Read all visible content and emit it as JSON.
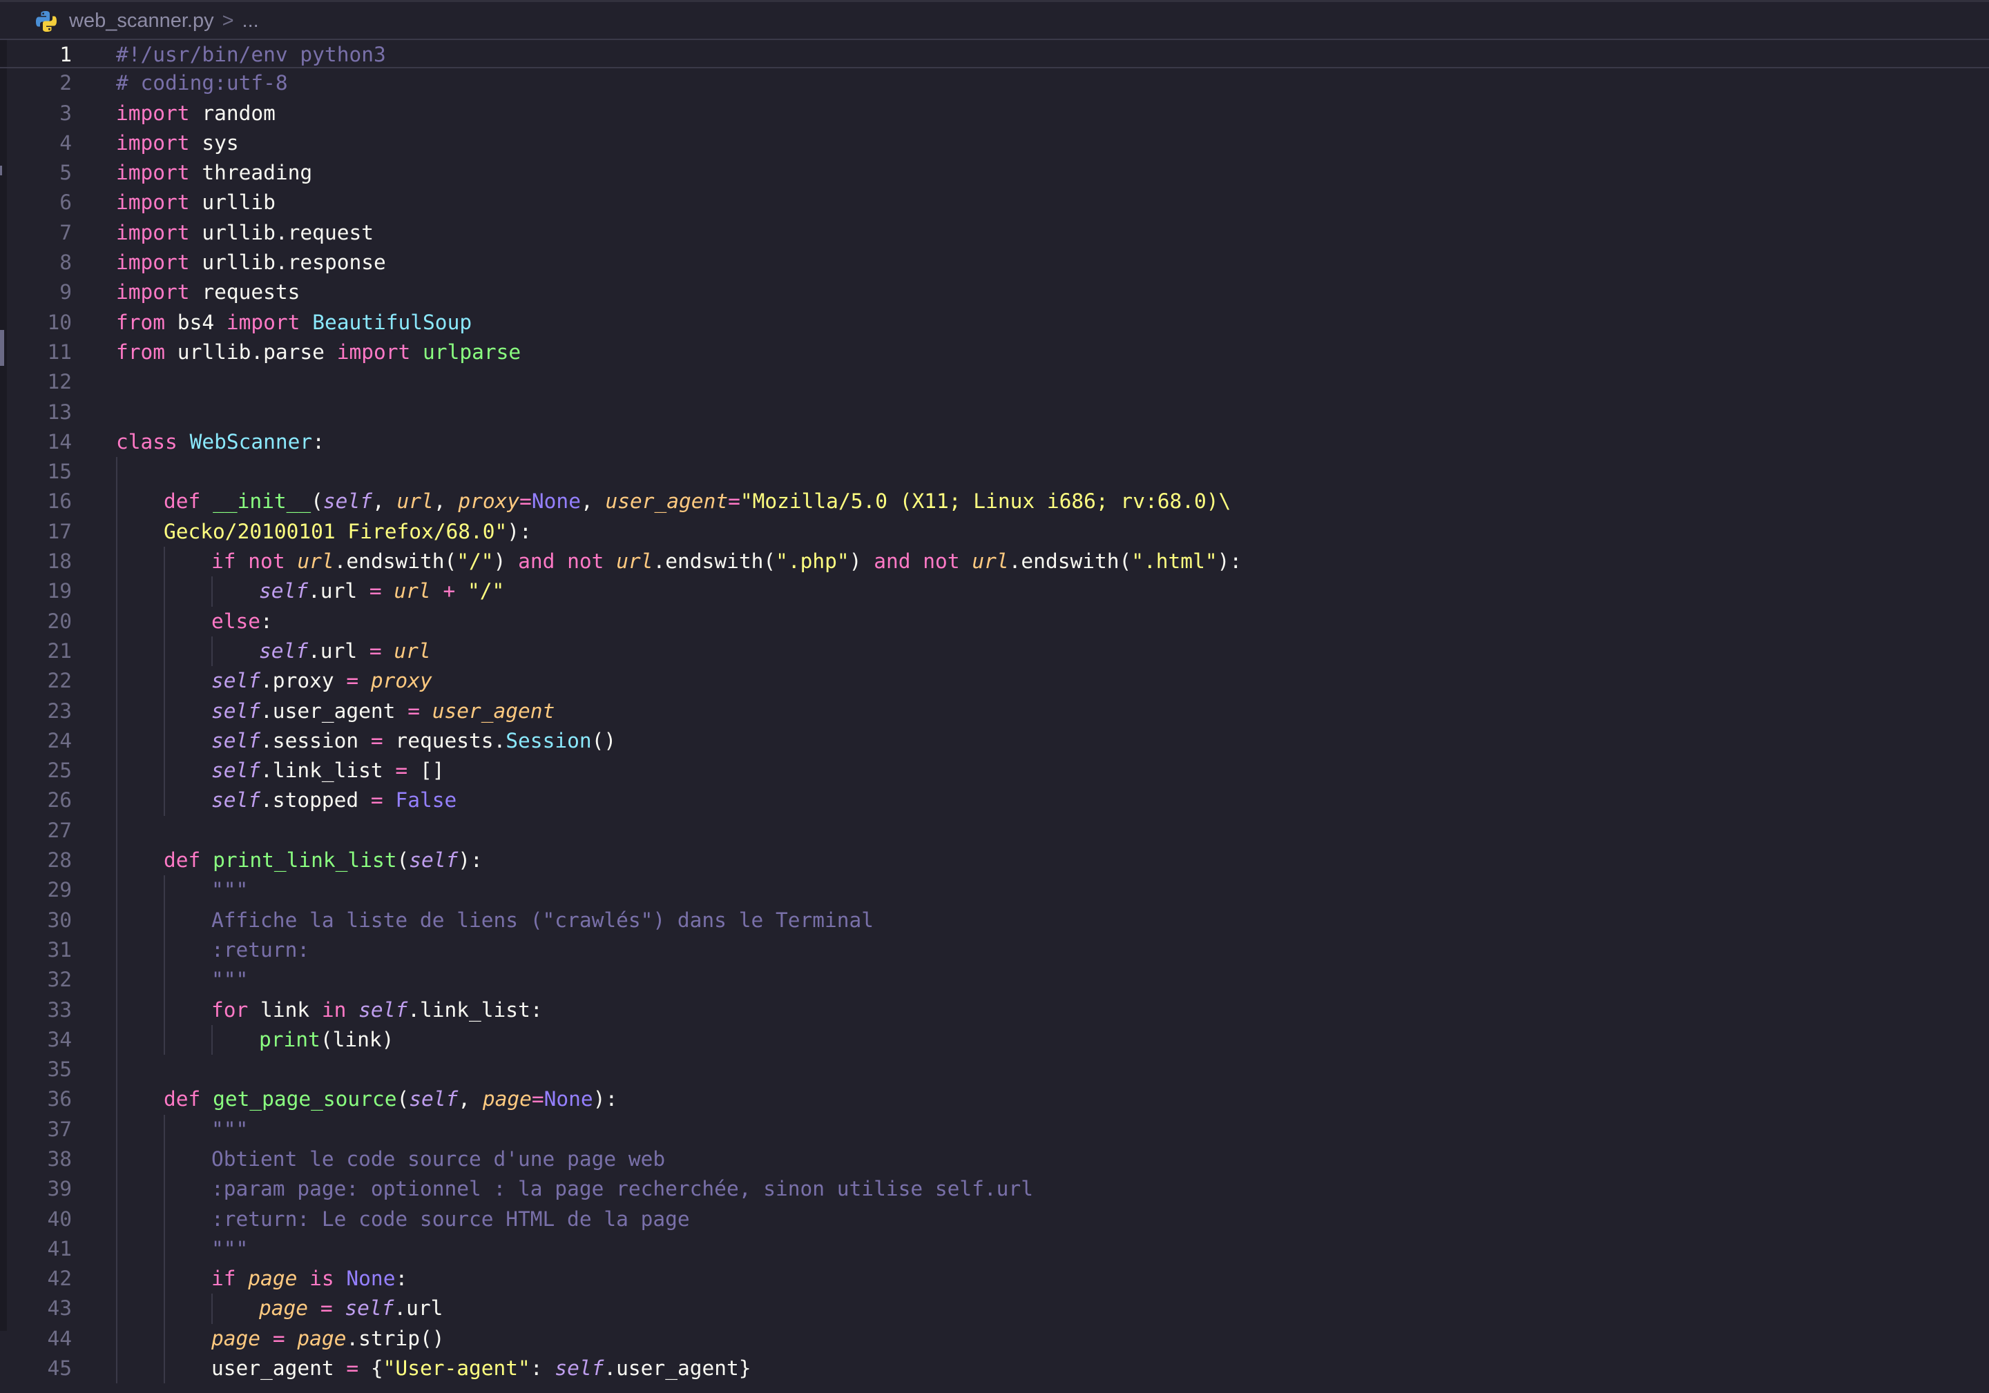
{
  "editor": {
    "breadcrumb": {
      "file": "web_scanner.py",
      "separator": ">",
      "more": "..."
    },
    "current_line": 1,
    "colors": {
      "background": "#22212c",
      "keyword": "#ff79c6",
      "comment": "#7970a9",
      "class_name": "#8be9fd",
      "function": "#8aff80",
      "self": "#bf9eee",
      "parameter": "#ffca80",
      "string": "#ffff80",
      "constant": "#9580ff"
    },
    "lines": [
      {
        "n": "1",
        "indent": 0,
        "tokens": [
          [
            "comment",
            "#!/usr/bin/env python3"
          ]
        ]
      },
      {
        "n": "2",
        "indent": 0,
        "tokens": [
          [
            "comment",
            "# coding:utf-8"
          ]
        ]
      },
      {
        "n": "3",
        "indent": 0,
        "tokens": [
          [
            "keyword",
            "import"
          ],
          [
            "plain",
            " random"
          ]
        ]
      },
      {
        "n": "4",
        "indent": 0,
        "tokens": [
          [
            "keyword",
            "import"
          ],
          [
            "plain",
            " sys"
          ]
        ]
      },
      {
        "n": "5",
        "indent": 0,
        "tokens": [
          [
            "keyword",
            "import"
          ],
          [
            "plain",
            " threading"
          ]
        ]
      },
      {
        "n": "6",
        "indent": 0,
        "tokens": [
          [
            "keyword",
            "import"
          ],
          [
            "plain",
            " urllib"
          ]
        ]
      },
      {
        "n": "7",
        "indent": 0,
        "tokens": [
          [
            "keyword",
            "import"
          ],
          [
            "plain",
            " urllib.request"
          ]
        ]
      },
      {
        "n": "8",
        "indent": 0,
        "tokens": [
          [
            "keyword",
            "import"
          ],
          [
            "plain",
            " urllib.response"
          ]
        ]
      },
      {
        "n": "9",
        "indent": 0,
        "tokens": [
          [
            "keyword",
            "import"
          ],
          [
            "plain",
            " requests"
          ]
        ]
      },
      {
        "n": "10",
        "indent": 0,
        "tokens": [
          [
            "keyword",
            "from"
          ],
          [
            "plain",
            " bs4 "
          ],
          [
            "keyword",
            "import"
          ],
          [
            "plain",
            " "
          ],
          [
            "class",
            "BeautifulSoup"
          ]
        ]
      },
      {
        "n": "11",
        "indent": 0,
        "tokens": [
          [
            "keyword",
            "from"
          ],
          [
            "plain",
            " urllib.parse "
          ],
          [
            "keyword",
            "import"
          ],
          [
            "plain",
            " "
          ],
          [
            "func",
            "urlparse"
          ]
        ]
      },
      {
        "n": "12",
        "indent": 0,
        "tokens": []
      },
      {
        "n": "13",
        "indent": 0,
        "tokens": []
      },
      {
        "n": "14",
        "indent": 0,
        "tokens": [
          [
            "keyword",
            "class"
          ],
          [
            "plain",
            " "
          ],
          [
            "class",
            "WebScanner"
          ],
          [
            "plain",
            ":"
          ]
        ]
      },
      {
        "n": "15",
        "indent": 1,
        "tokens": []
      },
      {
        "n": "16",
        "indent": 1,
        "tokens": [
          [
            "keyword",
            "def"
          ],
          [
            "plain",
            " "
          ],
          [
            "func",
            "__init__"
          ],
          [
            "plain",
            "("
          ],
          [
            "self",
            "self"
          ],
          [
            "plain",
            ", "
          ],
          [
            "param",
            "url"
          ],
          [
            "plain",
            ", "
          ],
          [
            "param",
            "proxy"
          ],
          [
            "op",
            "="
          ],
          [
            "const",
            "None"
          ],
          [
            "plain",
            ", "
          ],
          [
            "param",
            "user_agent"
          ],
          [
            "op",
            "="
          ],
          [
            "string",
            "\"Mozilla/5.0 (X11; Linux i686; rv:68.0)\\"
          ]
        ]
      },
      {
        "n": "17",
        "indent": 1,
        "tokens": [
          [
            "string",
            "Gecko/20100101 Firefox/68.0\""
          ],
          [
            "plain",
            "):"
          ]
        ]
      },
      {
        "n": "18",
        "indent": 2,
        "tokens": [
          [
            "keyword",
            "if"
          ],
          [
            "plain",
            " "
          ],
          [
            "keyword",
            "not"
          ],
          [
            "plain",
            " "
          ],
          [
            "param",
            "url"
          ],
          [
            "plain",
            ".endswith("
          ],
          [
            "string",
            "\"/\""
          ],
          [
            "plain",
            ") "
          ],
          [
            "keyword",
            "and"
          ],
          [
            "plain",
            " "
          ],
          [
            "keyword",
            "not"
          ],
          [
            "plain",
            " "
          ],
          [
            "param",
            "url"
          ],
          [
            "plain",
            ".endswith("
          ],
          [
            "string",
            "\".php\""
          ],
          [
            "plain",
            ") "
          ],
          [
            "keyword",
            "and"
          ],
          [
            "plain",
            " "
          ],
          [
            "keyword",
            "not"
          ],
          [
            "plain",
            " "
          ],
          [
            "param",
            "url"
          ],
          [
            "plain",
            ".endswith("
          ],
          [
            "string",
            "\".html\""
          ],
          [
            "plain",
            "):"
          ]
        ]
      },
      {
        "n": "19",
        "indent": 3,
        "tokens": [
          [
            "self",
            "self"
          ],
          [
            "plain",
            ".url "
          ],
          [
            "op",
            "="
          ],
          [
            "plain",
            " "
          ],
          [
            "param",
            "url"
          ],
          [
            "plain",
            " "
          ],
          [
            "op",
            "+"
          ],
          [
            "plain",
            " "
          ],
          [
            "string",
            "\"/\""
          ]
        ]
      },
      {
        "n": "20",
        "indent": 2,
        "tokens": [
          [
            "keyword",
            "else"
          ],
          [
            "plain",
            ":"
          ]
        ]
      },
      {
        "n": "21",
        "indent": 3,
        "tokens": [
          [
            "self",
            "self"
          ],
          [
            "plain",
            ".url "
          ],
          [
            "op",
            "="
          ],
          [
            "plain",
            " "
          ],
          [
            "param",
            "url"
          ]
        ]
      },
      {
        "n": "22",
        "indent": 2,
        "tokens": [
          [
            "self",
            "self"
          ],
          [
            "plain",
            ".proxy "
          ],
          [
            "op",
            "="
          ],
          [
            "plain",
            " "
          ],
          [
            "param",
            "proxy"
          ]
        ]
      },
      {
        "n": "23",
        "indent": 2,
        "tokens": [
          [
            "self",
            "self"
          ],
          [
            "plain",
            ".user_agent "
          ],
          [
            "op",
            "="
          ],
          [
            "plain",
            " "
          ],
          [
            "param",
            "user_agent"
          ]
        ]
      },
      {
        "n": "24",
        "indent": 2,
        "tokens": [
          [
            "self",
            "self"
          ],
          [
            "plain",
            ".session "
          ],
          [
            "op",
            "="
          ],
          [
            "plain",
            " requests."
          ],
          [
            "class",
            "Session"
          ],
          [
            "plain",
            "()"
          ]
        ]
      },
      {
        "n": "25",
        "indent": 2,
        "tokens": [
          [
            "self",
            "self"
          ],
          [
            "plain",
            ".link_list "
          ],
          [
            "op",
            "="
          ],
          [
            "plain",
            " []"
          ]
        ]
      },
      {
        "n": "26",
        "indent": 2,
        "tokens": [
          [
            "self",
            "self"
          ],
          [
            "plain",
            ".stopped "
          ],
          [
            "op",
            "="
          ],
          [
            "plain",
            " "
          ],
          [
            "const",
            "False"
          ]
        ]
      },
      {
        "n": "27",
        "indent": 1,
        "tokens": []
      },
      {
        "n": "28",
        "indent": 1,
        "tokens": [
          [
            "keyword",
            "def"
          ],
          [
            "plain",
            " "
          ],
          [
            "func",
            "print_link_list"
          ],
          [
            "plain",
            "("
          ],
          [
            "self",
            "self"
          ],
          [
            "plain",
            "):"
          ]
        ]
      },
      {
        "n": "29",
        "indent": 2,
        "tokens": [
          [
            "comment",
            "\"\"\""
          ]
        ]
      },
      {
        "n": "30",
        "indent": 2,
        "tokens": [
          [
            "comment",
            "Affiche la liste de liens (\"crawlés\") dans le Terminal"
          ]
        ]
      },
      {
        "n": "31",
        "indent": 2,
        "tokens": [
          [
            "comment",
            ":return:"
          ]
        ]
      },
      {
        "n": "32",
        "indent": 2,
        "tokens": [
          [
            "comment",
            "\"\"\""
          ]
        ]
      },
      {
        "n": "33",
        "indent": 2,
        "tokens": [
          [
            "keyword",
            "for"
          ],
          [
            "plain",
            " link "
          ],
          [
            "keyword",
            "in"
          ],
          [
            "plain",
            " "
          ],
          [
            "self",
            "self"
          ],
          [
            "plain",
            ".link_list:"
          ]
        ]
      },
      {
        "n": "34",
        "indent": 3,
        "tokens": [
          [
            "func",
            "print"
          ],
          [
            "plain",
            "(link)"
          ]
        ]
      },
      {
        "n": "35",
        "indent": 1,
        "tokens": []
      },
      {
        "n": "36",
        "indent": 1,
        "tokens": [
          [
            "keyword",
            "def"
          ],
          [
            "plain",
            " "
          ],
          [
            "func",
            "get_page_source"
          ],
          [
            "plain",
            "("
          ],
          [
            "self",
            "self"
          ],
          [
            "plain",
            ", "
          ],
          [
            "param",
            "page"
          ],
          [
            "op",
            "="
          ],
          [
            "const",
            "None"
          ],
          [
            "plain",
            "):"
          ]
        ]
      },
      {
        "n": "37",
        "indent": 2,
        "tokens": [
          [
            "comment",
            "\"\"\""
          ]
        ]
      },
      {
        "n": "38",
        "indent": 2,
        "tokens": [
          [
            "comment",
            "Obtient le code source d'une page web"
          ]
        ]
      },
      {
        "n": "39",
        "indent": 2,
        "tokens": [
          [
            "comment",
            ":param page: optionnel : la page recherchée, sinon utilise self.url"
          ]
        ]
      },
      {
        "n": "40",
        "indent": 2,
        "tokens": [
          [
            "comment",
            ":return: Le code source HTML de la page"
          ]
        ]
      },
      {
        "n": "41",
        "indent": 2,
        "tokens": [
          [
            "comment",
            "\"\"\""
          ]
        ]
      },
      {
        "n": "42",
        "indent": 2,
        "tokens": [
          [
            "keyword",
            "if"
          ],
          [
            "plain",
            " "
          ],
          [
            "param",
            "page"
          ],
          [
            "plain",
            " "
          ],
          [
            "keyword",
            "is"
          ],
          [
            "plain",
            " "
          ],
          [
            "const",
            "None"
          ],
          [
            "plain",
            ":"
          ]
        ]
      },
      {
        "n": "43",
        "indent": 3,
        "tokens": [
          [
            "param",
            "page"
          ],
          [
            "plain",
            " "
          ],
          [
            "op",
            "="
          ],
          [
            "plain",
            " "
          ],
          [
            "self",
            "self"
          ],
          [
            "plain",
            ".url"
          ]
        ]
      },
      {
        "n": "44",
        "indent": 2,
        "tokens": [
          [
            "param",
            "page"
          ],
          [
            "plain",
            " "
          ],
          [
            "op",
            "="
          ],
          [
            "plain",
            " "
          ],
          [
            "param",
            "page"
          ],
          [
            "plain",
            ".strip()"
          ]
        ]
      },
      {
        "n": "45",
        "indent": 2,
        "tokens": [
          [
            "plain",
            "user_agent "
          ],
          [
            "op",
            "="
          ],
          [
            "plain",
            " {"
          ],
          [
            "string",
            "\"User-agent\""
          ],
          [
            "plain",
            ": "
          ],
          [
            "self",
            "self"
          ],
          [
            "plain",
            ".user_agent}"
          ]
        ]
      }
    ]
  }
}
